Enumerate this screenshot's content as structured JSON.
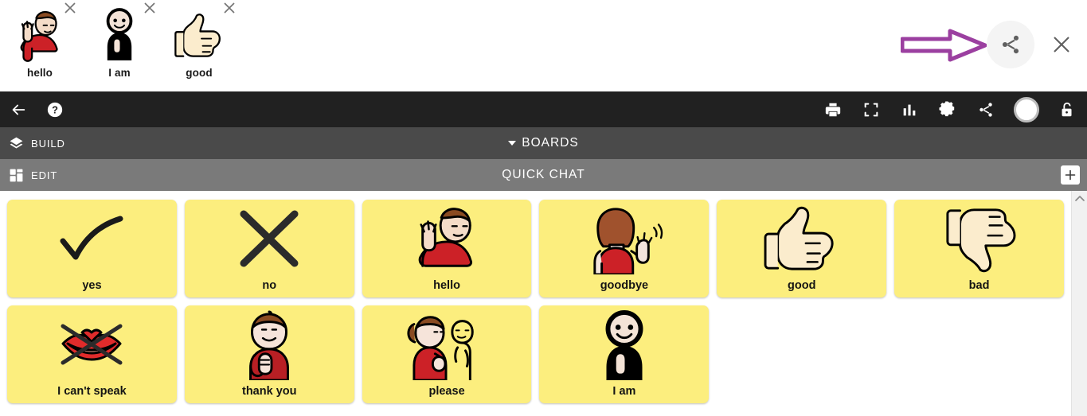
{
  "sentence_bar": {
    "items": [
      {
        "label": "hello",
        "symbol": "person-waving-hand",
        "delete_icon": "close-icon"
      },
      {
        "label": "I am",
        "symbol": "person-hand-on-chest-silhouette",
        "delete_icon": "close-icon"
      },
      {
        "label": "good",
        "symbol": "thumbs-up-hand",
        "delete_icon": "close-icon"
      }
    ],
    "share_button": {
      "icon": "share-icon",
      "background": "#f4f4f4"
    },
    "close_button": {
      "icon": "close-icon"
    },
    "annotation": {
      "type": "arrow",
      "direction": "right",
      "color": "#9b3fa0",
      "points_to": "share-button"
    }
  },
  "toolbar": {
    "background": "#212121",
    "left": [
      {
        "name": "back",
        "icon": "arrow-left-icon"
      },
      {
        "name": "help",
        "icon": "question-mark-circle-icon"
      }
    ],
    "right": [
      {
        "name": "print",
        "icon": "print-icon"
      },
      {
        "name": "fullscreen",
        "icon": "fullscreen-icon"
      },
      {
        "name": "analytics",
        "icon": "bar-chart-icon"
      },
      {
        "name": "settings",
        "icon": "gear-icon"
      },
      {
        "name": "share",
        "icon": "share-icon"
      },
      {
        "name": "account",
        "icon": "avatar-icon"
      },
      {
        "name": "lock",
        "icon": "unlock-icon"
      }
    ]
  },
  "build_bar": {
    "label": "BUILD",
    "icon": "layers-icon",
    "title": "BOARDS",
    "caret": "chevron-down-icon",
    "background": "#4a4a4a"
  },
  "edit_bar": {
    "label": "EDIT",
    "icon": "dashboard-grid-icon",
    "title": "QUICK CHAT",
    "add_button": "plus-icon",
    "background": "#7a7a7a"
  },
  "board": {
    "cell_color": "#fcee7e",
    "rows": [
      [
        {
          "label": "yes",
          "symbol": "checkmark"
        },
        {
          "label": "no",
          "symbol": "x-cross"
        },
        {
          "label": "hello",
          "symbol": "person-waving-hand"
        },
        {
          "label": "goodbye",
          "symbol": "person-back-waving"
        },
        {
          "label": "good",
          "symbol": "thumbs-up-hand"
        },
        {
          "label": "bad",
          "symbol": "thumbs-down-hand"
        }
      ],
      [
        {
          "label": "I can't speak",
          "symbol": "lips-crossed-out"
        },
        {
          "label": "thank you",
          "symbol": "person-hand-on-chest"
        },
        {
          "label": "please",
          "symbol": "two-people-talking"
        },
        {
          "label": "I am",
          "symbol": "person-hand-on-chest-silhouette"
        },
        {
          "label": "",
          "symbol": "empty"
        },
        {
          "label": "",
          "symbol": "empty"
        }
      ]
    ]
  },
  "scrollbar": {
    "up_arrow": "chevron-up-icon"
  }
}
